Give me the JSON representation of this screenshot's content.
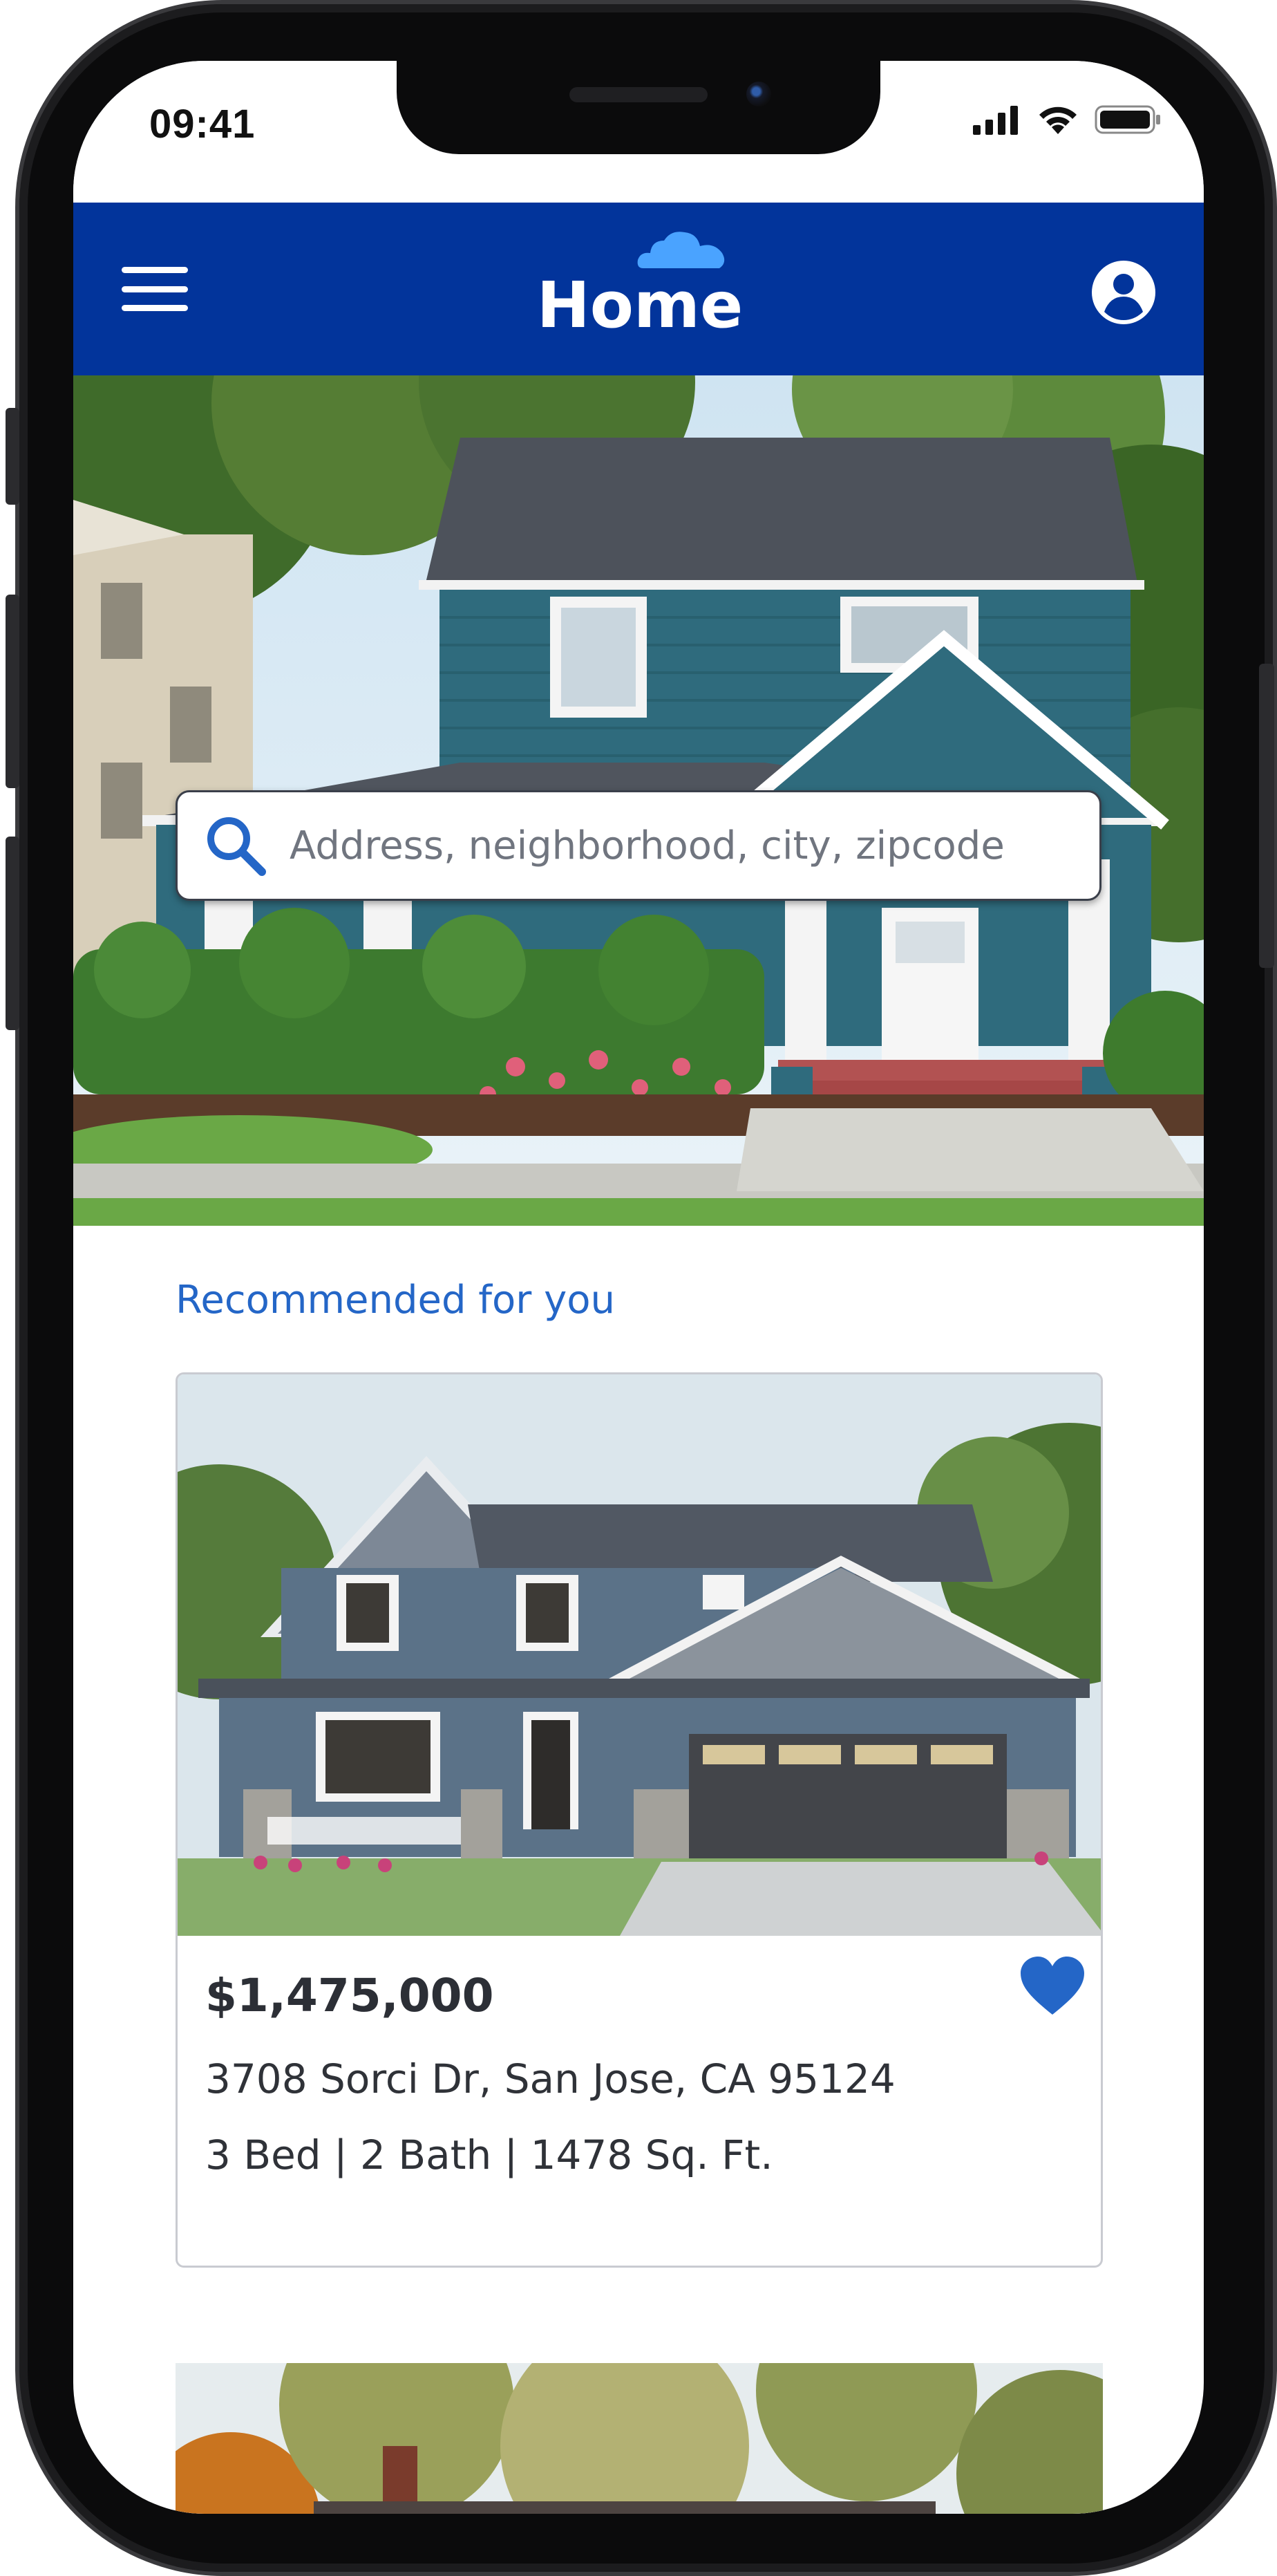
{
  "status_bar": {
    "time": "09:41"
  },
  "header": {
    "title": "Home",
    "menu_icon": "hamburger-menu-icon",
    "profile_icon": "account-circle-icon",
    "brand_color": "#02349b"
  },
  "search": {
    "placeholder": "Address, neighborhood, city, zipcode",
    "icon": "search-icon",
    "icon_color": "#2466c7"
  },
  "recommended": {
    "title": "Recommended for you",
    "title_color": "#2466c7",
    "listings": [
      {
        "price": "$1,475,000",
        "address": "3708 Sorci Dr, San Jose, CA 95124",
        "specs": "3 Bed | 2 Bath | 1478 Sq. Ft.",
        "favorited": true,
        "favorite_icon": "heart-icon"
      }
    ]
  }
}
